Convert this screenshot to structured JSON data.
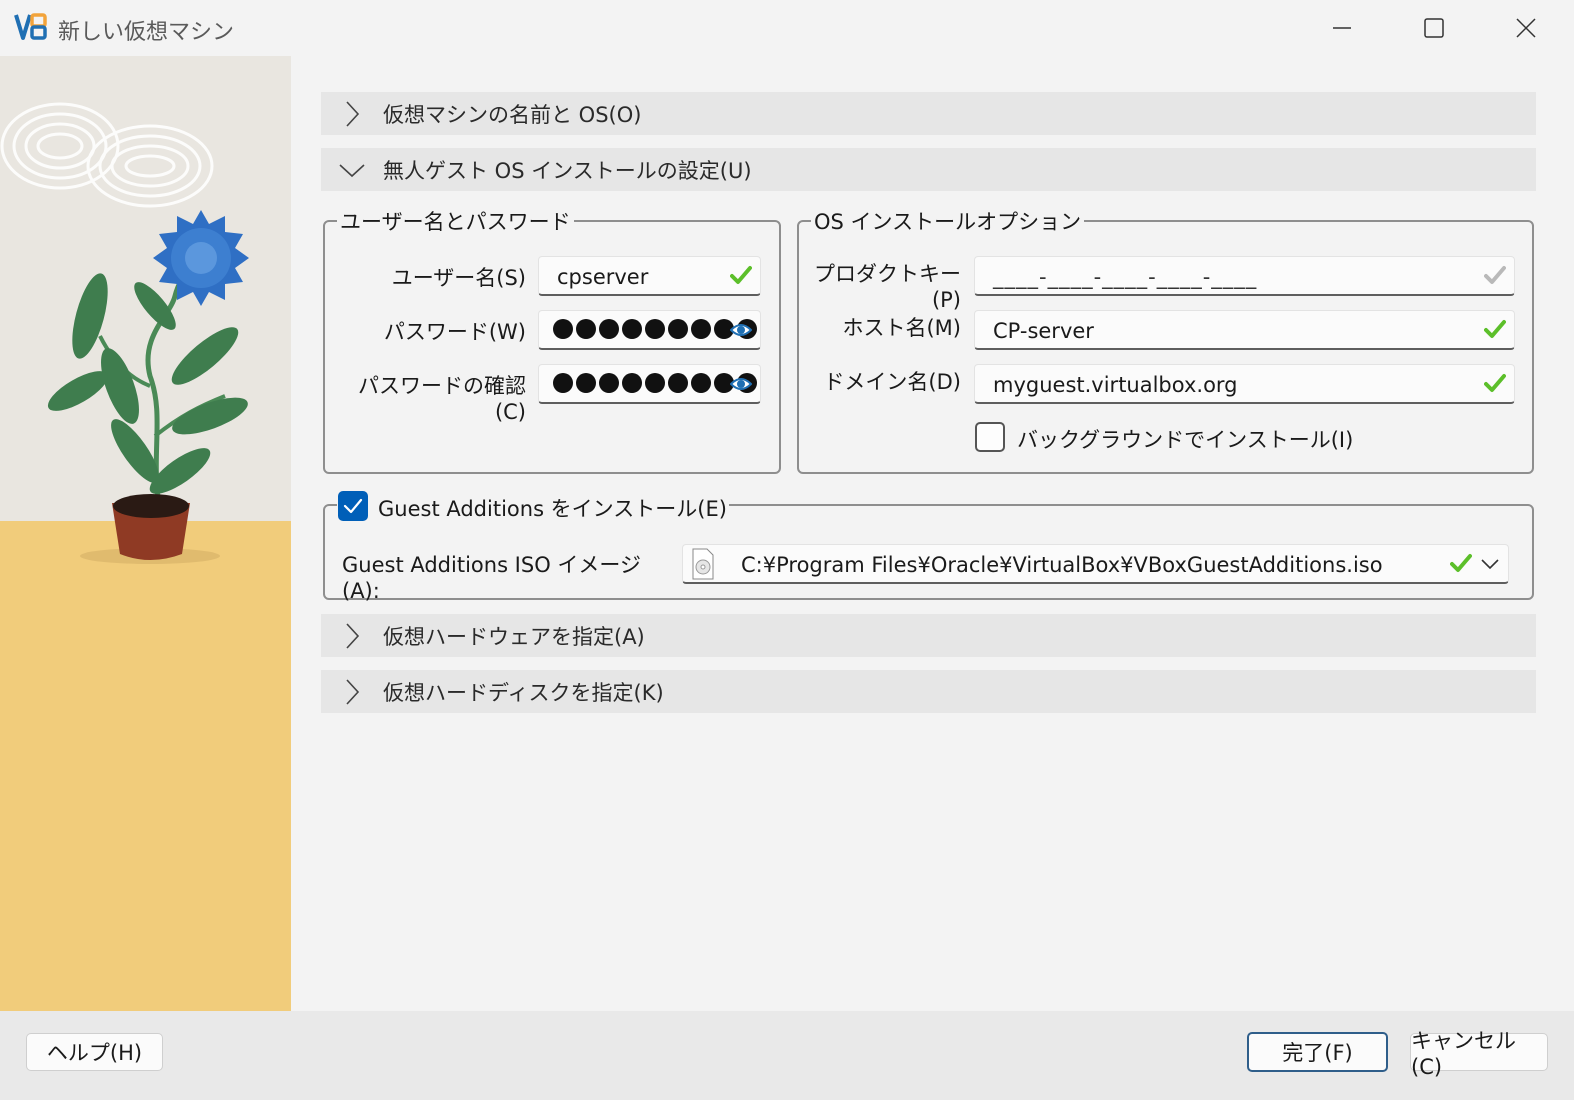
{
  "window": {
    "title": "新しい仮想マシン",
    "icon": "virtualbox-icon",
    "controls": [
      "minimize-icon",
      "maximize-icon",
      "close-icon"
    ]
  },
  "sections": {
    "name_os": {
      "label": "仮想マシンの名前と OS(O)",
      "expanded": false
    },
    "unattended": {
      "label": "無人ゲスト OS インストールの設定(U)",
      "expanded": true
    },
    "hardware": {
      "label": "仮想ハードウェアを指定(A)",
      "expanded": false
    },
    "disk": {
      "label": "仮想ハードディスクを指定(K)",
      "expanded": false
    }
  },
  "user_group": {
    "title": "ユーザー名とパスワード",
    "username_label": "ユーザー名(S)",
    "username_value": "cpserver",
    "password_label": "パスワード(W)",
    "password_confirm_label": "パスワードの確認(C)"
  },
  "os_group": {
    "title": "OS インストールオプション",
    "product_key_label": "プロダクトキー(P)",
    "product_key_value": "____-____-____-____-____",
    "hostname_label": "ホスト名(M)",
    "hostname_value": "CP-server",
    "domain_label": "ドメイン名(D)",
    "domain_value": "myguest.virtualbox.org",
    "background_install_label": "バックグラウンドでインストール(I)",
    "background_install_checked": false
  },
  "guest_additions": {
    "checkbox_label": "Guest Additions をインストール(E)",
    "checked": true,
    "iso_label": "Guest Additions ISO イメージ(A):",
    "iso_value": "C:¥Program Files¥Oracle¥VirtualBox¥VBoxGuestAdditions.iso"
  },
  "footer": {
    "help_label": "ヘルプ(H)",
    "finish_label": "完了(F)",
    "cancel_label": "キャンセル(C)"
  },
  "colors": {
    "accent": "#005fb8",
    "valid_check": "#5cbf2a",
    "art_wall": "#e9e6e0",
    "art_floor": "#f1cc7b",
    "flower": "#3d7fd0",
    "leaf": "#3f7d4e",
    "pot": "#8f3a24"
  }
}
